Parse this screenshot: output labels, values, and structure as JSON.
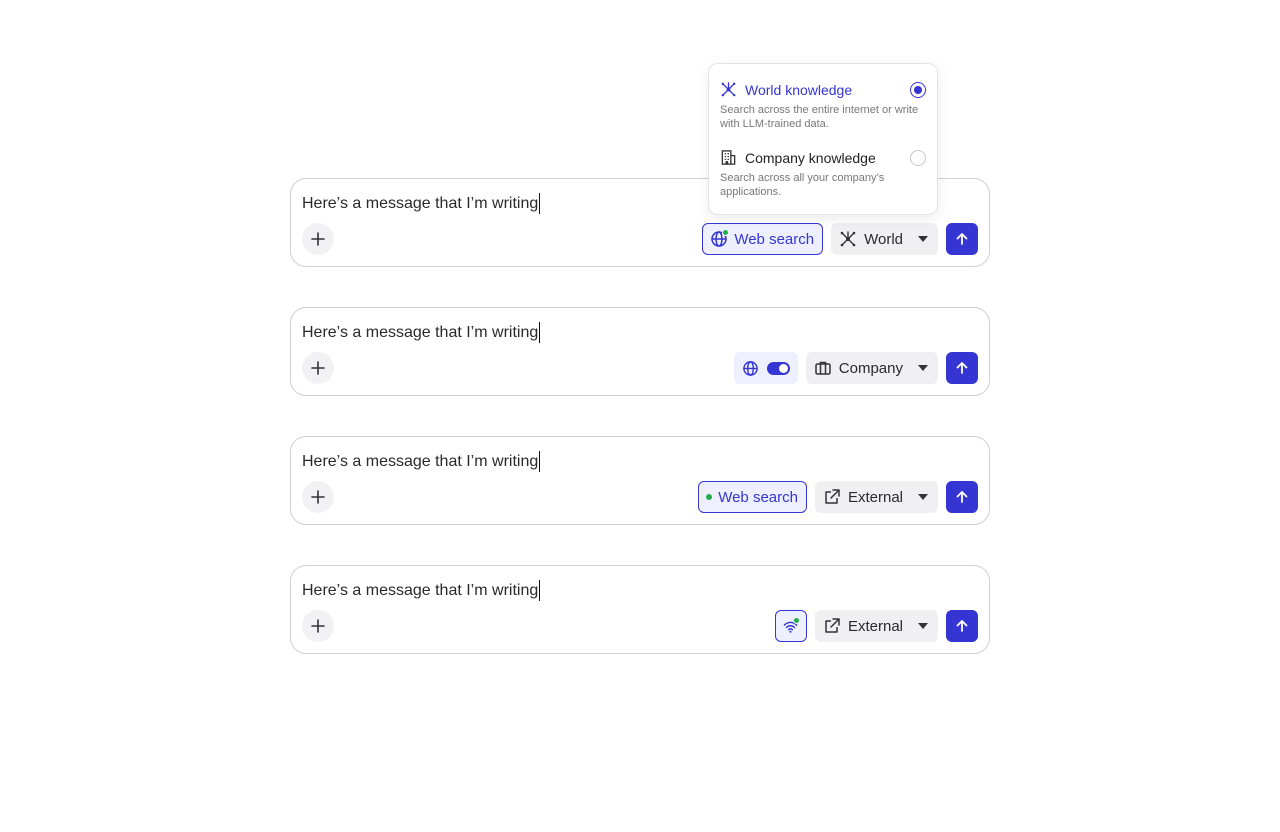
{
  "composers": [
    {
      "message": "Here’s a message that I’m writing",
      "web_search_label": "Web search",
      "knowledge_label": "World"
    },
    {
      "message": "Here’s a message that I’m writing",
      "knowledge_label": "Company"
    },
    {
      "message": "Here’s a message that I’m writing",
      "web_search_label": "Web search",
      "knowledge_label": "External"
    },
    {
      "message": "Here’s a message that I’m writing",
      "knowledge_label": "External"
    }
  ],
  "popover": {
    "options": [
      {
        "title": "World knowledge",
        "description": "Search across the entire internet or write with LLM-trained data.",
        "selected": true,
        "icon": "network-icon"
      },
      {
        "title": "Company knowledge",
        "description": "Search across all your company’s applications.",
        "selected": false,
        "icon": "building-icon"
      }
    ]
  },
  "colors": {
    "accent": "#3535d4",
    "accent_bg": "#eef0ff",
    "status_green": "#23b04b",
    "chip_bg": "#f0f0f2",
    "border": "#cfcfd4"
  }
}
